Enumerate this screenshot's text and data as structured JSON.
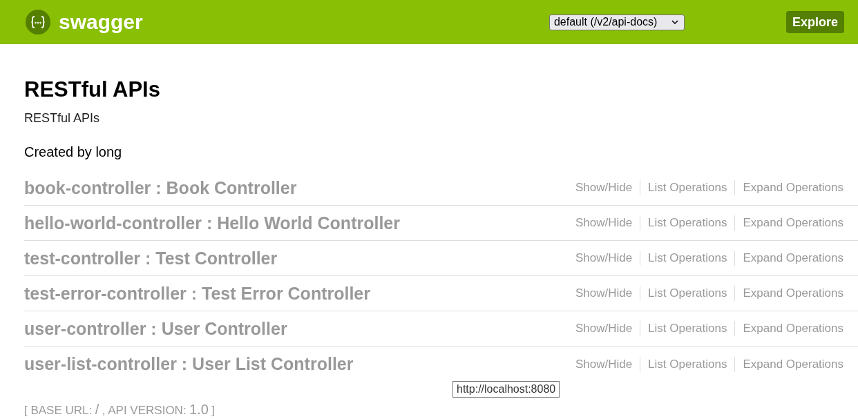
{
  "header": {
    "brand": "swagger",
    "api_selector": {
      "value": "default (/v2/api-docs)"
    },
    "explore_button": "Explore"
  },
  "info": {
    "title": "RESTful APIs",
    "description": "RESTful APIs",
    "contact": "Created by long"
  },
  "resources": [
    {
      "heading": "book-controller : Book Controller",
      "actions": [
        "Show/Hide",
        "List Operations",
        "Expand Operations"
      ]
    },
    {
      "heading": "hello-world-controller : Hello World Controller",
      "actions": [
        "Show/Hide",
        "List Operations",
        "Expand Operations"
      ]
    },
    {
      "heading": "test-controller : Test Controller",
      "actions": [
        "Show/Hide",
        "List Operations",
        "Expand Operations"
      ]
    },
    {
      "heading": "test-error-controller : Test Error Controller",
      "actions": [
        "Show/Hide",
        "List Operations",
        "Expand Operations"
      ]
    },
    {
      "heading": "user-controller : User Controller",
      "actions": [
        "Show/Hide",
        "List Operations",
        "Expand Operations"
      ]
    },
    {
      "heading": "user-list-controller : User List Controller",
      "actions": [
        "Show/Hide",
        "List Operations",
        "Expand Operations"
      ]
    }
  ],
  "footer": {
    "parts": [
      {
        "kind": "label",
        "text": "[ BASE URL:"
      },
      {
        "kind": "value",
        "text": "/"
      },
      {
        "kind": "label",
        "text": ", API VERSION:"
      },
      {
        "kind": "value",
        "text": "1.0"
      },
      {
        "kind": "label",
        "text": "]"
      }
    ]
  },
  "tooltip": {
    "text": "http://localhost:8080"
  }
}
